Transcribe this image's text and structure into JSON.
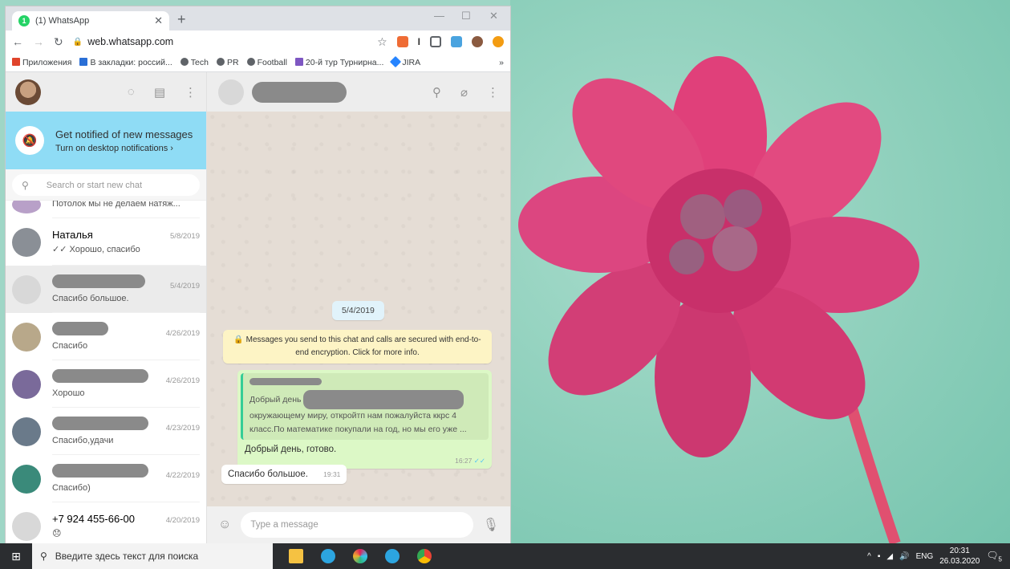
{
  "browser": {
    "tab_title": "(1) WhatsApp",
    "tab_badge": "1",
    "url": "web.whatsapp.com",
    "bookmarks": [
      "Приложения",
      "В закладки: россий...",
      "Tech",
      "PR",
      "Football",
      "20-й тур Турнирна...",
      "JIRA",
      "»"
    ]
  },
  "whatsapp": {
    "notify": {
      "title": "Get notified of new messages",
      "link": "Turn on desktop notifications ›"
    },
    "search_placeholder": "Search or start new chat",
    "chats": [
      {
        "name": "",
        "preview": "Потолок мы не делаем натяж...",
        "date": "",
        "redacted_name": false
      },
      {
        "name": "Наталья",
        "preview": "✓✓ Хорошо, спасибо",
        "date": "5/8/2019",
        "redacted_name": false
      },
      {
        "name": "",
        "preview": "Спасибо большое.",
        "date": "5/4/2019",
        "redacted_name": true
      },
      {
        "name": "",
        "preview": "Спасибо",
        "date": "4/26/2019",
        "redacted_name": true
      },
      {
        "name": "",
        "preview": "Хорошо",
        "date": "4/26/2019",
        "redacted_name": true
      },
      {
        "name": "",
        "preview": "Спасибо,удачи",
        "date": "4/23/2019",
        "redacted_name": true
      },
      {
        "name": "",
        "preview": "Спасибо)",
        "date": "4/22/2019",
        "redacted_name": true
      },
      {
        "name": "+7 924 455-66-00",
        "preview": "😞",
        "date": "4/20/2019",
        "redacted_name": false
      }
    ],
    "conversation": {
      "date_chip": "5/4/2019",
      "encryption_note": "🔒 Messages you send to this chat and calls are secured with end-to-end encryption. Click for more info.",
      "quote_line1": "Добрый день",
      "quote_line2": "окружающему миру, откройтп нам пожалуйста ккрс 4",
      "quote_line3": "класс.По математике покупали на год, но мы его уже ...",
      "outgoing_text": "Добрый день, готово.",
      "outgoing_time": "16:27",
      "incoming_text": "Спасибо большое.",
      "incoming_time": "19:31"
    },
    "composer_placeholder": "Type a message"
  },
  "taskbar": {
    "search_placeholder": "Введите здесь текст для поиска",
    "lang": "ENG",
    "time": "20:31",
    "date": "26.03.2020",
    "notif_count": "5"
  }
}
